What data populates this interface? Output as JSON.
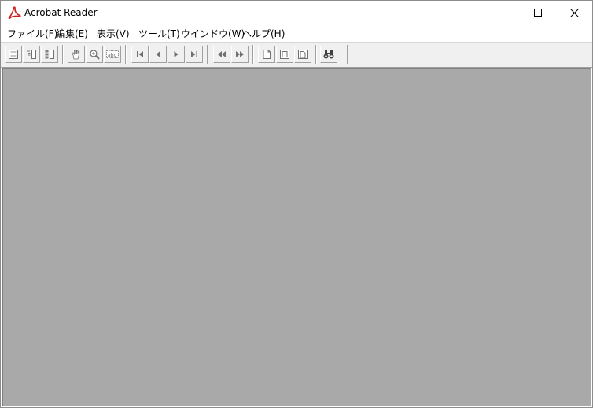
{
  "window": {
    "title": "Acrobat Reader",
    "caption_icons": [
      "minimize-icon",
      "maximize-icon",
      "close-icon"
    ]
  },
  "menu": {
    "items": [
      "ファイル(F)",
      "編集(E)",
      "表示(V)",
      "ツール(T)",
      "ウインドウ(W)",
      "ヘルプ(H)"
    ]
  },
  "toolbar": {
    "icons": [
      "page-only-icon",
      "bookmarks-and-page-icon",
      "thumbnails-and-page-icon",
      "hand-tool-icon",
      "zoom-tool-icon",
      "text-select-tool-icon",
      "first-page-icon",
      "previous-page-icon",
      "next-page-icon",
      "last-page-icon",
      "go-back-icon",
      "go-forward-icon",
      "actual-size-icon",
      "fit-page-icon",
      "fit-width-icon",
      "find-icon"
    ]
  },
  "colors": {
    "document_background": "#a9a9a9",
    "toolbar_background": "#f0f0f0",
    "logo_red": "#cc1f1f"
  }
}
